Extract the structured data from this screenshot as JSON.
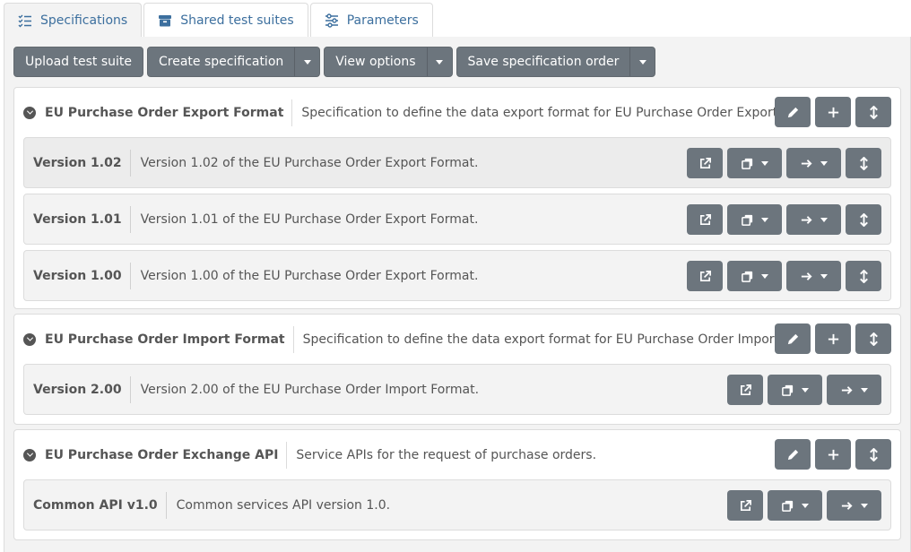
{
  "tabs": [
    {
      "label": "Specifications",
      "icon": "list-check-icon",
      "active": true
    },
    {
      "label": "Shared test suites",
      "icon": "archive-icon",
      "active": false
    },
    {
      "label": "Parameters",
      "icon": "sliders-icon",
      "active": false
    }
  ],
  "toolbar": {
    "upload_label": "Upload test suite",
    "create_label": "Create specification",
    "view_label": "View options",
    "save_label": "Save specification order"
  },
  "specs": [
    {
      "name": "EU Purchase Order Export Format",
      "desc": "Specification to define the data export format for EU Purchase Order Exports.",
      "versions": [
        {
          "name": "Version 1.02",
          "desc": "Version 1.02 of the EU Purchase Order Export Format."
        },
        {
          "name": "Version 1.01",
          "desc": "Version 1.01 of the EU Purchase Order Export Format."
        },
        {
          "name": "Version 1.00",
          "desc": "Version 1.00 of the EU Purchase Order Export Format."
        }
      ]
    },
    {
      "name": "EU Purchase Order Import Format",
      "desc": "Specification to define the data export format for EU Purchase Order Imports.",
      "versions": [
        {
          "name": "Version 2.00",
          "desc": "Version 2.00 of the EU Purchase Order Import Format."
        }
      ]
    },
    {
      "name": "EU Purchase Order Exchange API",
      "desc": "Service APIs for the request of purchase orders.",
      "versions": [
        {
          "name": "Common API v1.0",
          "desc": "Common services API version 1.0."
        }
      ]
    }
  ],
  "colors": {
    "button": "#6c757d",
    "tab_text": "#3c6f9e",
    "panel_bg": "#f3f3f3"
  }
}
